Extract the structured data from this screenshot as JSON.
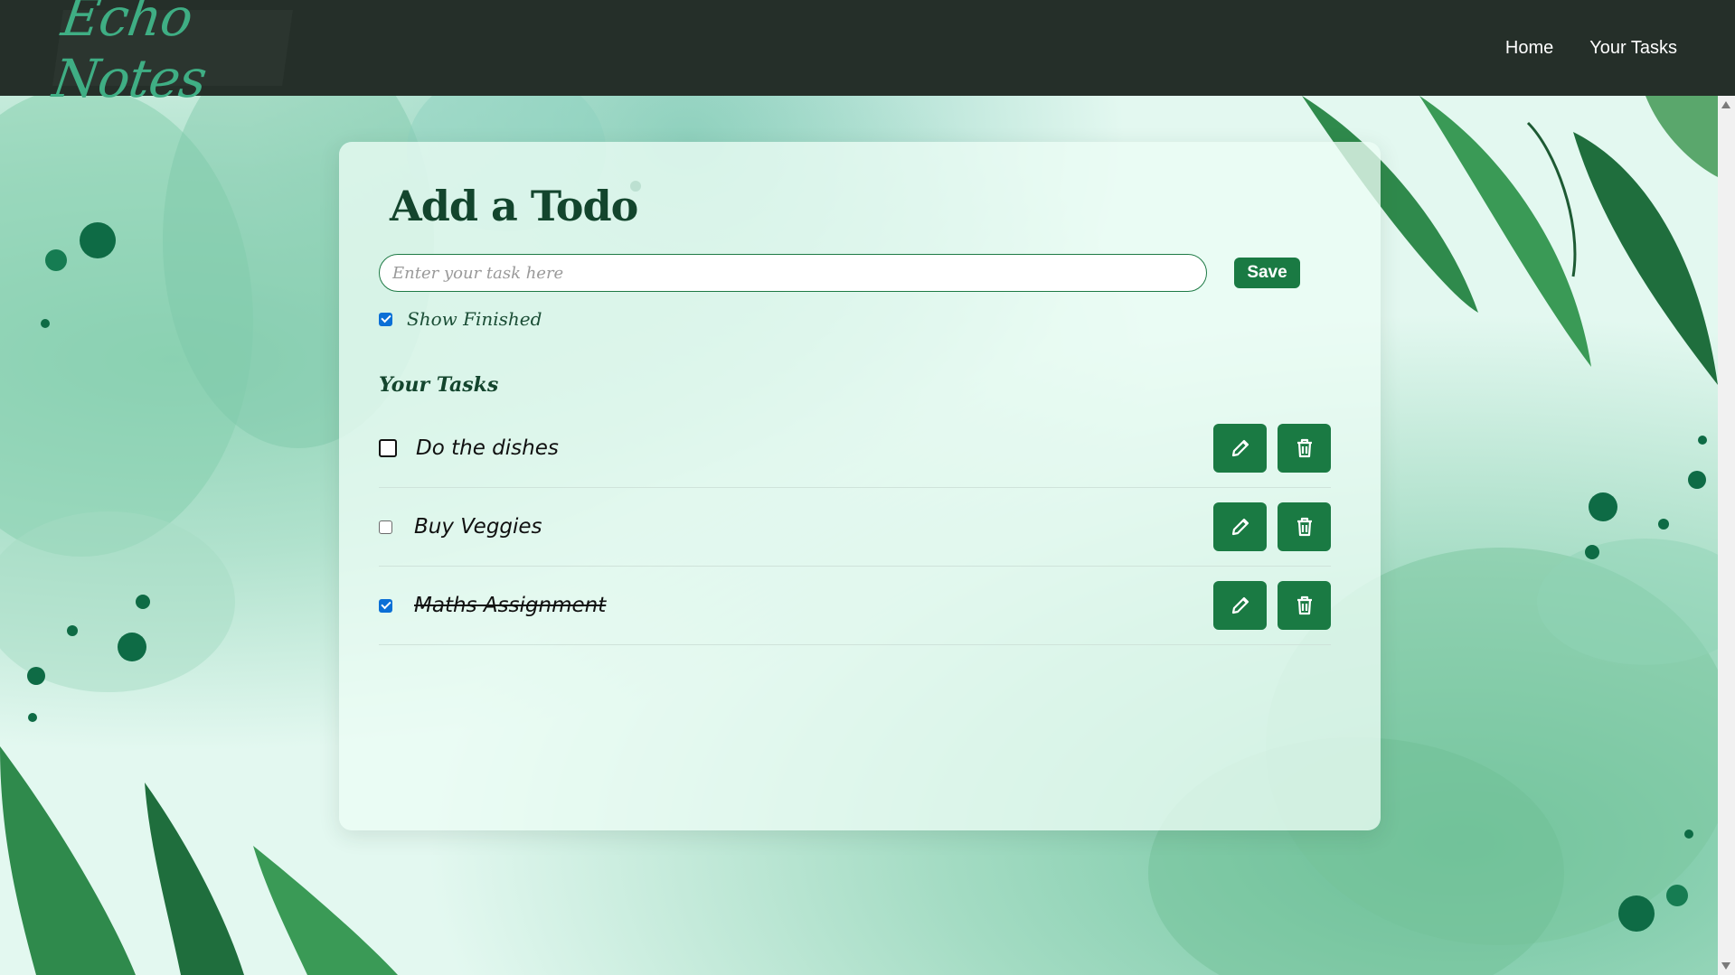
{
  "navbar": {
    "brand": "Echo Notes",
    "links": [
      {
        "label": "Home"
      },
      {
        "label": "Your Tasks"
      }
    ]
  },
  "form": {
    "title": "Add a Todo",
    "placeholder": "Enter your task here",
    "value": "",
    "save_label": "Save",
    "show_finished_label": "Show Finished",
    "show_finished_checked": true
  },
  "tasks_section": {
    "heading": "Your Tasks",
    "items": [
      {
        "text": "Do the dishes",
        "completed": false
      },
      {
        "text": "Buy Veggies",
        "completed": false
      },
      {
        "text": "Maths Assignment",
        "completed": true
      }
    ]
  },
  "colors": {
    "navbar_bg": "#252f29",
    "accent": "#1a7a43",
    "brand": "#3fae84",
    "checkbox_checked": "#0b6fd6"
  },
  "icons": {
    "edit": "pencil-icon",
    "delete": "trash-icon"
  }
}
